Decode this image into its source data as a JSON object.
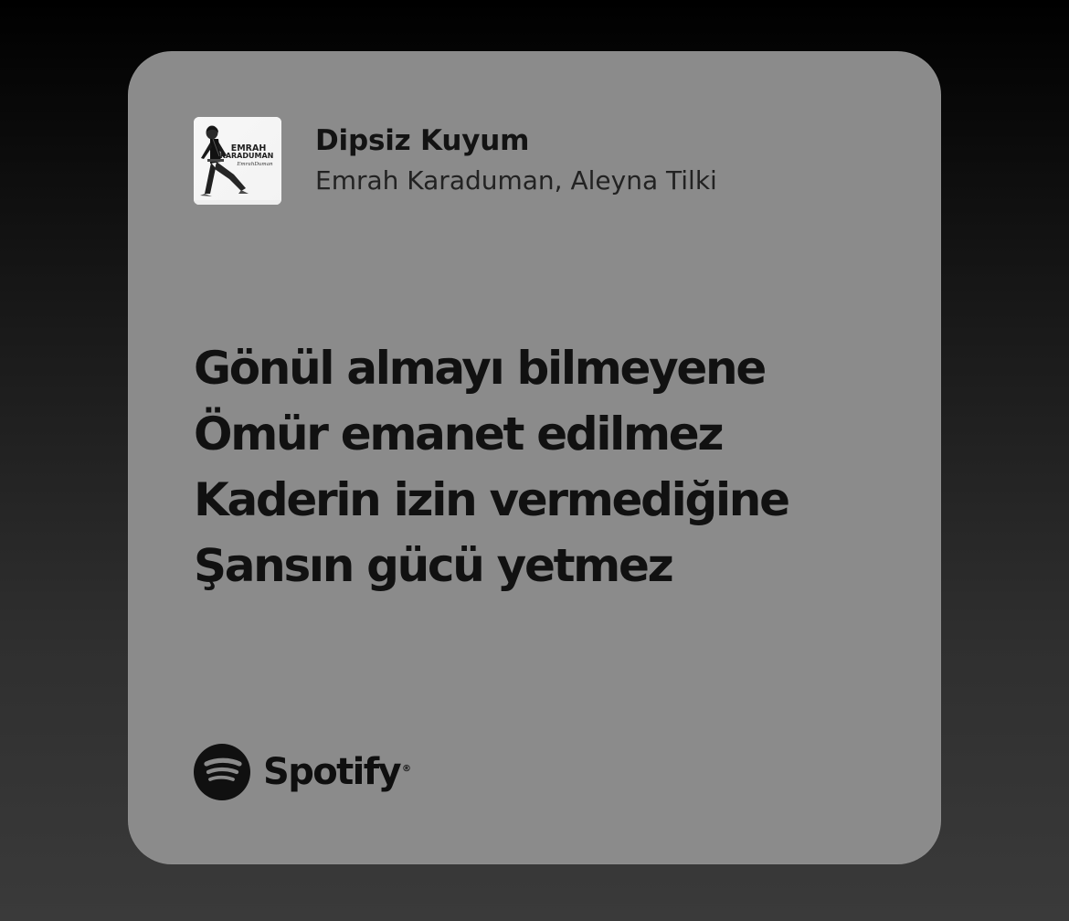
{
  "card": {
    "background": "#8b8b8b",
    "song_title": "Dipsiz Kuyum",
    "artist": "Emrah Karaduman, Aleyna Tilki",
    "lyrics": [
      "Gönül almayı bilmeyene",
      "Ömür emanet edilmez",
      "Kaderin izin vermediğine",
      "Şansın gücü yetmez"
    ],
    "album_art": {
      "title_line_1": "EMRAH",
      "title_line_2": "KARADUMAN",
      "signature": "EmrahDuman"
    },
    "brand": {
      "name": "Spotify",
      "icon": "spotify-icon"
    }
  }
}
